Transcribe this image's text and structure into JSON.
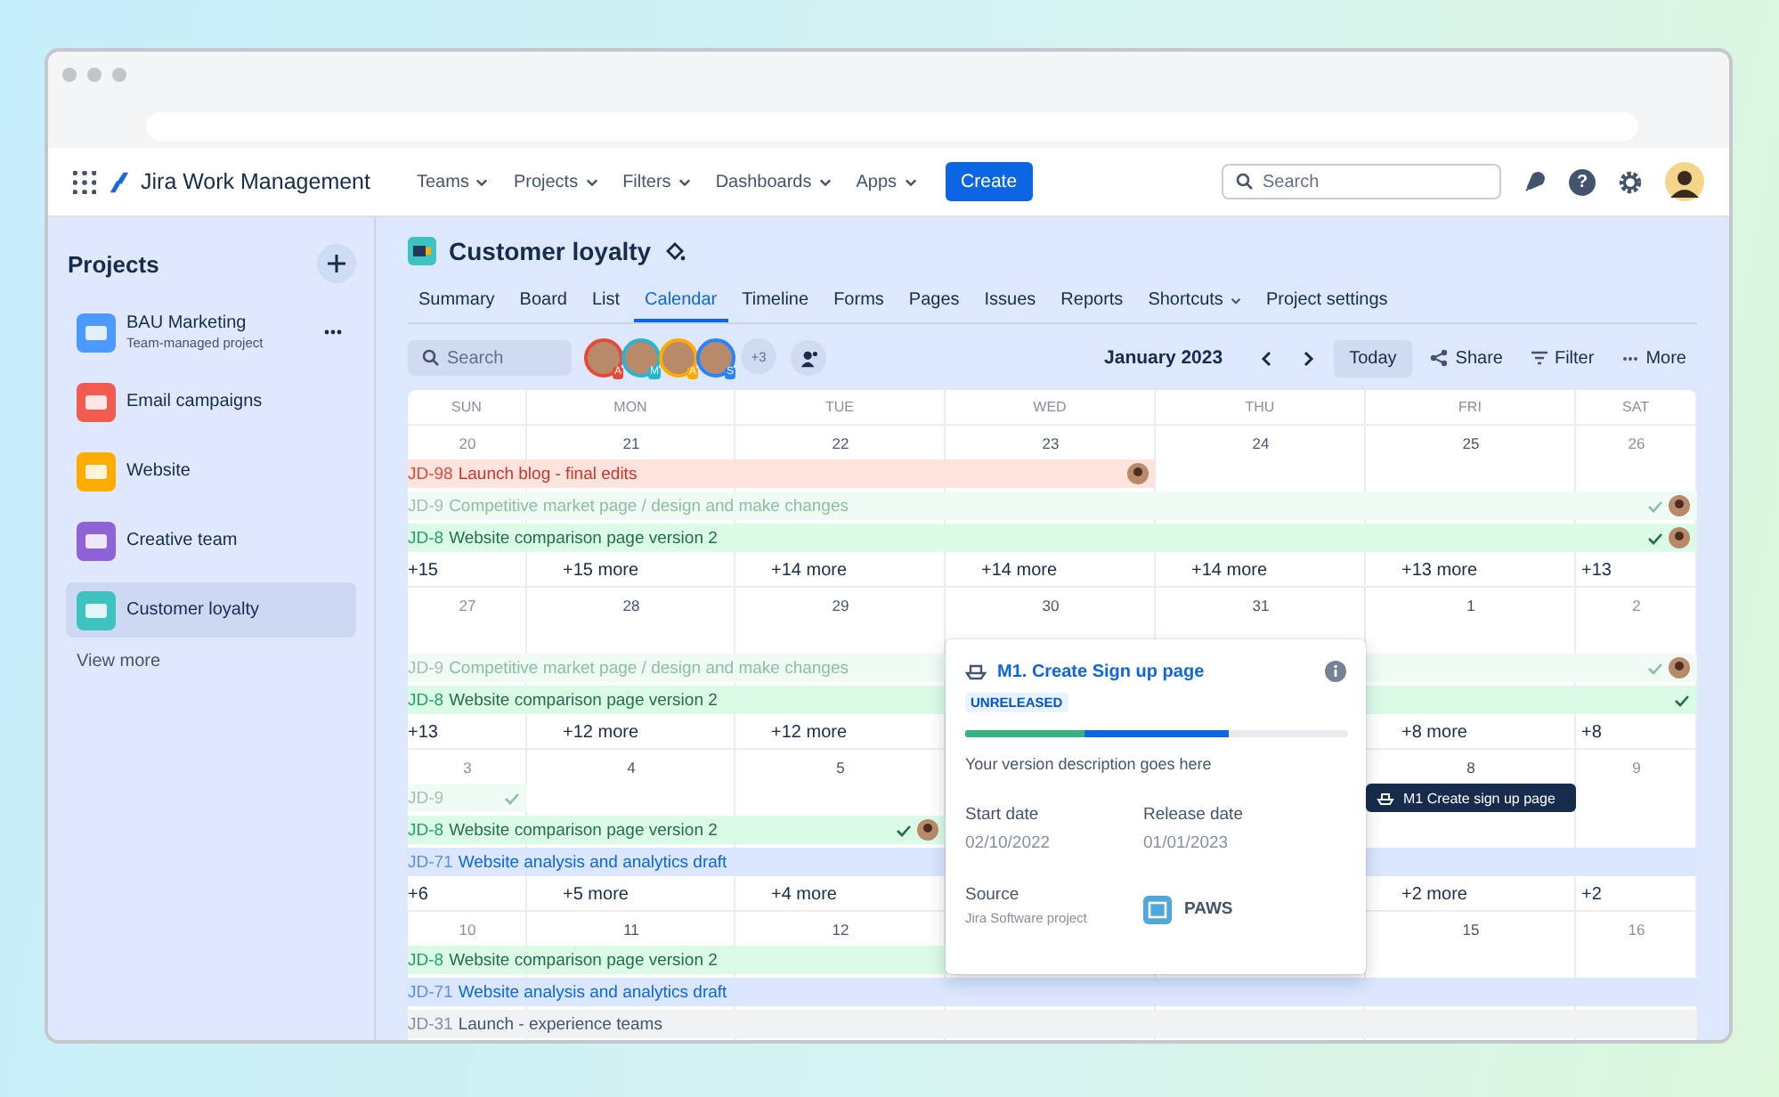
{
  "nav": {
    "product": "Jira Work Management",
    "menus": [
      {
        "label": "Teams"
      },
      {
        "label": "Projects"
      },
      {
        "label": "Filters"
      },
      {
        "label": "Dashboards"
      },
      {
        "label": "Apps"
      }
    ],
    "create": "Create",
    "search": {
      "placeholder": "Search"
    },
    "help": "?"
  },
  "sidebar": {
    "title": "Projects",
    "items": [
      {
        "name": "BAU Marketing",
        "subtitle": "Team-managed project",
        "color": "#4c9aff",
        "selected": false,
        "menu": true
      },
      {
        "name": "Email campaigns",
        "color": "#f15b50",
        "selected": false,
        "menu": false
      },
      {
        "name": "Website",
        "color": "#ffab00",
        "selected": false,
        "menu": false
      },
      {
        "name": "Creative team",
        "color": "#8f62d8",
        "selected": false,
        "menu": false
      },
      {
        "name": "Customer loyalty",
        "color": "#3ec3c0",
        "selected": true,
        "menu": false
      }
    ],
    "view_more": "View more"
  },
  "project": {
    "title": "Customer loyalty",
    "tabs": [
      {
        "label": "Summary",
        "selected": false,
        "dropdown": false
      },
      {
        "label": "Board",
        "selected": false,
        "dropdown": false
      },
      {
        "label": "List",
        "selected": false,
        "dropdown": false
      },
      {
        "label": "Calendar",
        "selected": true,
        "dropdown": false
      },
      {
        "label": "Timeline",
        "selected": false,
        "dropdown": false
      },
      {
        "label": "Forms",
        "selected": false,
        "dropdown": false
      },
      {
        "label": "Pages",
        "selected": false,
        "dropdown": false
      },
      {
        "label": "Issues",
        "selected": false,
        "dropdown": false
      },
      {
        "label": "Reports",
        "selected": false,
        "dropdown": false
      },
      {
        "label": "Shortcuts",
        "selected": false,
        "dropdown": true
      },
      {
        "label": "Project settings",
        "selected": false,
        "dropdown": false
      }
    ]
  },
  "toolbar": {
    "search": {
      "placeholder": "Search"
    },
    "avatars": [
      {
        "badge": "A",
        "color": "#e5493a"
      },
      {
        "badge": "M",
        "color": "#26b5d9"
      },
      {
        "badge": "A",
        "color": "#ffab00"
      },
      {
        "badge": "S",
        "color": "#2684ff"
      }
    ],
    "extra": "+3",
    "month": "January 2023",
    "today": "Today",
    "share": "Share",
    "filter": "Filter",
    "more": "More"
  },
  "calendar": {
    "days": [
      "SUN",
      "MON",
      "TUE",
      "WED",
      "THU",
      "FRI",
      "SAT"
    ],
    "weeks": [
      {
        "blank_row": false,
        "dates": {
          "sun": "20",
          "mon": "21",
          "tue": "22",
          "wed": "23",
          "thu": "24",
          "fri": "25",
          "sat": "26"
        },
        "events": {
          "sun_wed": [
            {
              "kind": "overdue",
              "key": "JD-98",
              "title": "Launch blog - final edits",
              "checked": false,
              "avatar": true
            }
          ],
          "sun_sat": [
            {
              "kind": "done",
              "key": "JD-9",
              "title": "Competitive market page / design and make changes",
              "checked": true,
              "avatar": true
            },
            {
              "kind": "review",
              "key": "JD-8",
              "title": "Website comparison page version 2",
              "checked": true,
              "avatar": true
            }
          ]
        },
        "more": {
          "sun": "+15",
          "mon": "+15 more",
          "tue": "+14 more",
          "wed": "+14 more",
          "thu": "+14 more",
          "fri": "+13 more",
          "sat": "+13"
        }
      },
      {
        "blank_row": true,
        "dates": {
          "sun": "27",
          "mon": "28",
          "tue": "29",
          "wed": "30",
          "thu": "31",
          "fri": "1",
          "sat": "2"
        },
        "events": {
          "sun_sat": [
            {
              "kind": "done",
              "key": "JD-9",
              "title": "Competitive market page / design and make changes",
              "checked": true,
              "avatar": true
            },
            {
              "kind": "review",
              "key": "JD-8",
              "title": "Website comparison page version 2",
              "checked": true,
              "avatar": false
            }
          ]
        },
        "more": {
          "sun": "+13",
          "mon": "+12 more",
          "tue": "+12 more",
          "fri": "+8 more",
          "sat": "+8"
        }
      },
      {
        "blank_row": false,
        "dates": {
          "sun": "3",
          "mon": "4",
          "tue": "5",
          "fri": "8",
          "sat": "9"
        },
        "events": {
          "sun_sun": [
            {
              "kind": "done",
              "key": "JD-9",
              "checked": true,
              "avatar": false
            }
          ],
          "fri_fri": [
            {
              "kind": "release",
              "title": "M1 Create sign up page"
            }
          ],
          "sun_tue": [
            {
              "kind": "review",
              "key": "JD-8",
              "title": "Website comparison page version 2",
              "checked": true,
              "avatar": true
            }
          ],
          "sun_sat": [
            {
              "kind": "in_progress",
              "key": "JD-71",
              "title": "Website analysis and analytics draft",
              "checked": false,
              "avatar": false
            }
          ]
        },
        "more": {
          "sun": "+6",
          "mon": "+5 more",
          "tue": "+4 more",
          "fri": "+2 more",
          "sat": "+2"
        }
      },
      {
        "blank_row": false,
        "dates": {
          "sun": "10",
          "mon": "11",
          "tue": "12",
          "fri": "15",
          "sat": "16"
        },
        "events": {
          "sun_wed": [
            {
              "kind": "review",
              "key": "JD-8",
              "title": "Website comparison page version 2"
            }
          ],
          "sun_sat": [
            {
              "kind": "in_progress",
              "key": "JD-71",
              "title": "Website analysis and analytics draft",
              "checked": false,
              "avatar": false
            },
            {
              "kind": "todo",
              "key": "JD-31",
              "title": "Launch - experience teams",
              "checked": false,
              "avatar": false
            }
          ]
        }
      }
    ]
  },
  "popup": {
    "title": "M1. Create Sign up page",
    "status": "UNRELEASED",
    "progress": [
      {
        "level": 0.69,
        "color": "#0c66e4"
      },
      {
        "level": 0.31,
        "color": "#36b37e"
      }
    ],
    "description": "Your version description goes here",
    "fields": [
      {
        "label": "Start date",
        "value": "02/10/2022"
      },
      {
        "label": "Release date",
        "value": "01/01/2023"
      }
    ],
    "source": {
      "label": "Source",
      "detail": "Jira Software project",
      "name": "PAWS"
    }
  }
}
